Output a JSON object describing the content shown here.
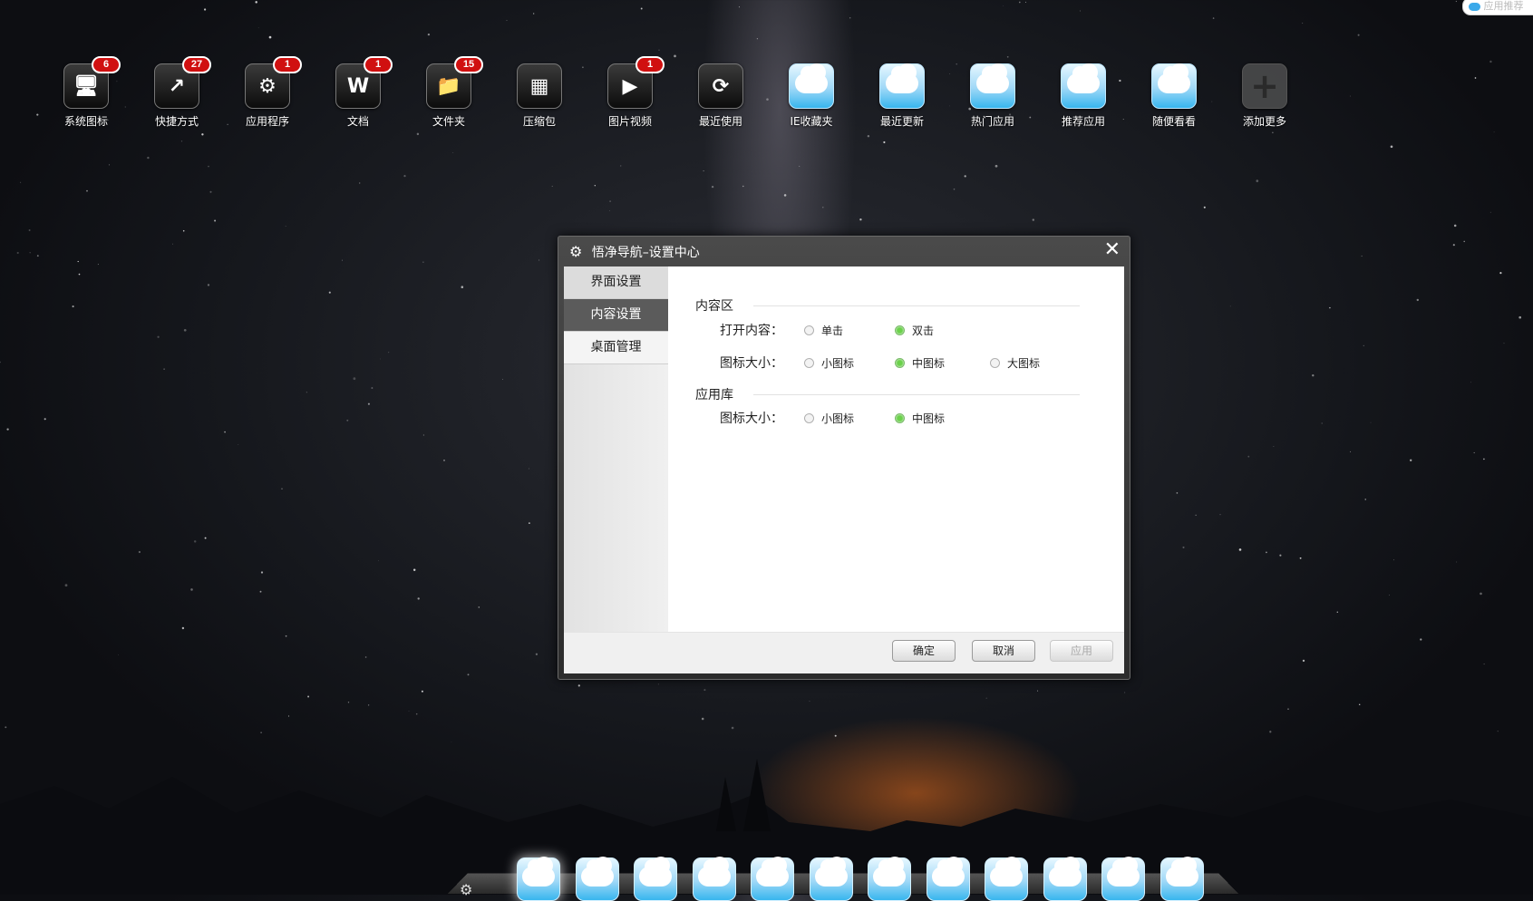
{
  "desktop_icons": [
    {
      "label": "系统图标",
      "badge": "6",
      "kind": "computer",
      "glyph": "🖥"
    },
    {
      "label": "快捷方式",
      "badge": "27",
      "kind": "shortcut",
      "glyph": "↗"
    },
    {
      "label": "应用程序",
      "badge": "1",
      "kind": "application",
      "glyph": "⚙"
    },
    {
      "label": "文档",
      "badge": "1",
      "kind": "document",
      "glyph": "W"
    },
    {
      "label": "文件夹",
      "badge": "15",
      "kind": "folder",
      "glyph": "📁"
    },
    {
      "label": "压缩包",
      "badge": "",
      "kind": "archive",
      "glyph": "▦"
    },
    {
      "label": "图片视频",
      "badge": "1",
      "kind": "media",
      "glyph": "▶"
    },
    {
      "label": "最近使用",
      "badge": "",
      "kind": "recent",
      "glyph": "⟳"
    },
    {
      "label": "IE收藏夹",
      "badge": "",
      "kind": "cloud",
      "glyph": ""
    },
    {
      "label": "最近更新",
      "badge": "",
      "kind": "cloud",
      "glyph": ""
    },
    {
      "label": "热门应用",
      "badge": "",
      "kind": "cloud",
      "glyph": ""
    },
    {
      "label": "推荐应用",
      "badge": "",
      "kind": "cloud",
      "glyph": ""
    },
    {
      "label": "随便看看",
      "badge": "",
      "kind": "cloud",
      "glyph": ""
    },
    {
      "label": "添加更多",
      "badge": "",
      "kind": "add",
      "glyph": "+"
    }
  ],
  "top_right_tab": {
    "label": "应用推荐"
  },
  "dialog": {
    "title": "悟净导航–设置中心",
    "close_glyph": "✕",
    "gear_glyph": "⚙",
    "nav": [
      "界面设置",
      "内容设置",
      "桌面管理"
    ],
    "active_nav": "内容设置",
    "sections": {
      "content_area": {
        "title": "内容区",
        "open_label": "打开内容：",
        "open_options": [
          "单击",
          "双击"
        ],
        "open_selected": "双击",
        "size_label": "图标大小：",
        "size_options": [
          "小图标",
          "中图标",
          "大图标"
        ],
        "size_selected": "中图标"
      },
      "app_library": {
        "title": "应用库",
        "size_label": "图标大小：",
        "size_options": [
          "小图标",
          "中图标"
        ],
        "size_selected": "中图标"
      }
    },
    "buttons": {
      "ok": "确定",
      "cancel": "取消",
      "apply": "应用"
    }
  },
  "dock": {
    "item_count": 12,
    "gear_glyph": "⚙"
  },
  "colors": {
    "badge": "#d01010",
    "radio_selected": "#6bd14b",
    "active_nav": "#5b5b5b"
  }
}
